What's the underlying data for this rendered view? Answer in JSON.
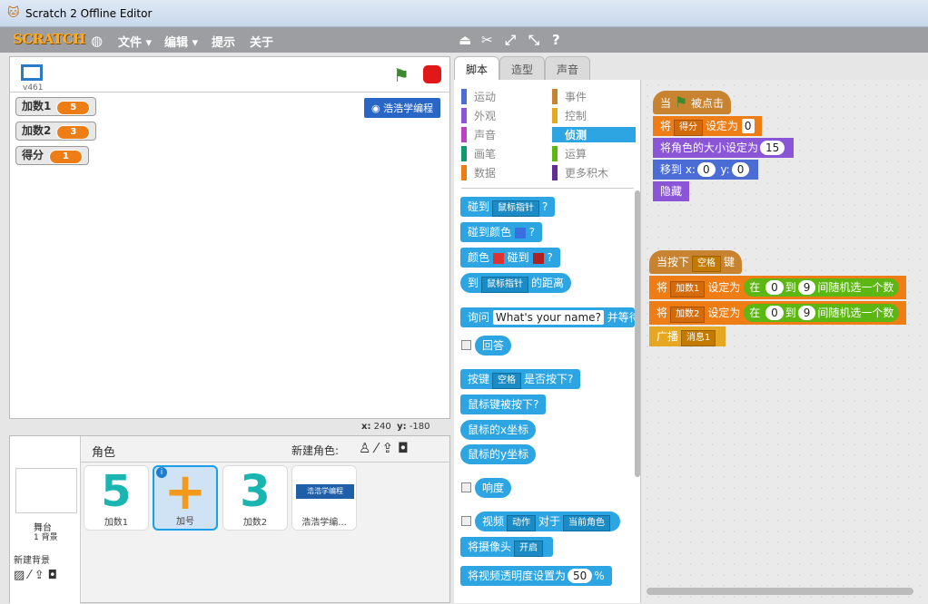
{
  "window": {
    "title": "Scratch 2 Offline Editor"
  },
  "menubar": {
    "logo": "SCRATCH",
    "items": [
      "文件 ▾",
      "编辑 ▾",
      "提示",
      "关于"
    ]
  },
  "stage": {
    "version": "v461",
    "vars": [
      {
        "name": "加数1",
        "value": "5"
      },
      {
        "name": "加数2",
        "value": "3"
      },
      {
        "name": "得分",
        "value": "1"
      }
    ],
    "button": "浩浩学编程",
    "coord_x_label": "x:",
    "coord_x": "240",
    "coord_y_label": "y:",
    "coord_y": "-180"
  },
  "sprites": {
    "title": "角色",
    "new_sprite": "新建角色:",
    "stage_label": "舞台",
    "stage_sub": "1 背景",
    "new_backdrop": "新建背景",
    "items": [
      {
        "name": "加数1",
        "glyph": "5"
      },
      {
        "name": "加号",
        "glyph": "+"
      },
      {
        "name": "加数2",
        "glyph": "3"
      },
      {
        "name": "浩浩学编...",
        "glyph": "浩浩学编程"
      }
    ]
  },
  "tabs": [
    "脚本",
    "造型",
    "声音"
  ],
  "categories": {
    "left": [
      {
        "label": "运动",
        "color": "#4a6cd4"
      },
      {
        "label": "外观",
        "color": "#8a55d7"
      },
      {
        "label": "声音",
        "color": "#bb42c3"
      },
      {
        "label": "画笔",
        "color": "#0e9a6c"
      },
      {
        "label": "数据",
        "color": "#ee7d16"
      }
    ],
    "right": [
      {
        "label": "事件",
        "color": "#c88330"
      },
      {
        "label": "控制",
        "color": "#e6a822"
      },
      {
        "label": "侦测",
        "color": "#2ca5e2"
      },
      {
        "label": "运算",
        "color": "#5cb712"
      },
      {
        "label": "更多积木",
        "color": "#632d99"
      }
    ]
  },
  "palette": {
    "touching": "碰到",
    "touching_dd": "鼠标指针",
    "q": "?",
    "touching_color": "碰到颜色",
    "color": "颜色",
    "touch2": "碰到",
    "to": "到",
    "dist_dd": "鼠标指针",
    "dist": "的距离",
    "ask": "询问",
    "ask_default": "What's your name?",
    "ask_wait": "并等待",
    "answer": "回答",
    "key": "按键",
    "key_dd": "空格",
    "key_pressed": "是否按下?",
    "mouse_down": "鼠标键被按下?",
    "mouse_x": "鼠标的x坐标",
    "mouse_y": "鼠标的y坐标",
    "loudness": "响度",
    "video": "视频",
    "video_dd": "动作",
    "video_on": "对于",
    "video_target": "当前角色",
    "camera": "将摄像头",
    "camera_dd": "开启",
    "transp": "将视频透明度设置为",
    "transp_val": "50",
    "pct": "%"
  },
  "script1": {
    "when": "当",
    "clicked": "被点击",
    "set": "将",
    "set_var": "得分",
    "set_to": "设定为",
    "set_val": "0",
    "size": "将角色的大小设定为",
    "size_val": "15",
    "goto": "移到 x:",
    "gx": "0",
    "gy_label": "y:",
    "gy": "0",
    "hide": "隐藏"
  },
  "script2": {
    "when_key": "当按下",
    "key": "空格",
    "key_end": "键",
    "set": "将",
    "v1": "加数1",
    "v2": "加数2",
    "set_to": "设定为",
    "in": "在",
    "from": "0",
    "to": "到",
    "max": "9",
    "rand": "间随机选一个数",
    "broadcast": "广播",
    "msg": "消息1"
  }
}
